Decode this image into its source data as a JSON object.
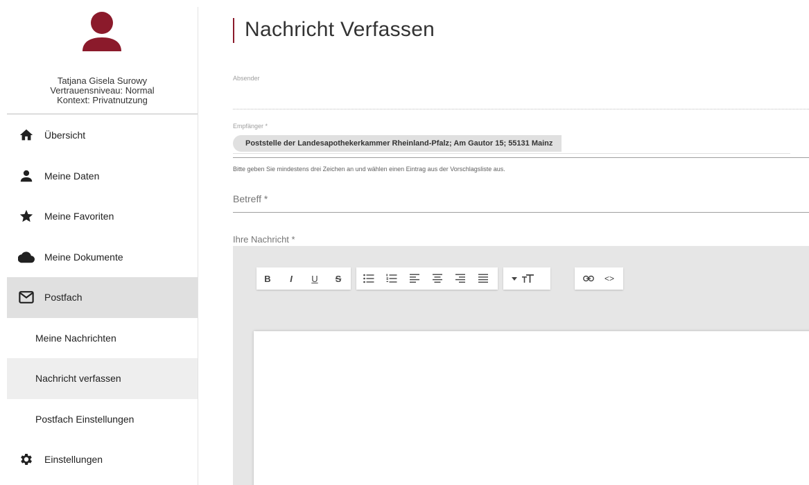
{
  "profile": {
    "name": "Tatjana Gisela Surowy",
    "trust_level": "Vertrauensniveau: Normal",
    "context": "Kontext: Privatnutzung"
  },
  "nav": {
    "items": [
      {
        "label": "Übersicht",
        "icon": "home-icon"
      },
      {
        "label": "Meine Daten",
        "icon": "person-icon"
      },
      {
        "label": "Meine Favoriten",
        "icon": "star-icon"
      },
      {
        "label": "Meine Dokumente",
        "icon": "cloud-icon"
      },
      {
        "label": "Postfach",
        "icon": "mail-icon"
      },
      {
        "label": "Meine Nachrichten"
      },
      {
        "label": "Nachricht verfassen"
      },
      {
        "label": "Postfach Einstellungen"
      },
      {
        "label": "Einstellungen",
        "icon": "gear-icon"
      }
    ]
  },
  "page": {
    "title": "Nachricht Verfassen"
  },
  "form": {
    "sender_label": "Absender",
    "recipient_label": "Empfänger *",
    "recipient_chip": "Poststelle der Landesapothekerkammer Rheinland-Pfalz; Am Gautor 15; 55131 Mainz",
    "recipient_hint": "Bitte geben Sie mindestens drei Zeichen an und wählen einen Eintrag aus der Vorschlagsliste aus.",
    "subject_label": "Betreff *",
    "message_label": "Ihre Nachricht *"
  },
  "toolbar": {
    "bold": "B",
    "italic": "I",
    "underline": "U",
    "strike": "S",
    "code": "<>"
  },
  "colors": {
    "accent": "#8b1a2b",
    "active_bg": "#e0e0e0",
    "editor_bg": "#e6e6e6"
  }
}
